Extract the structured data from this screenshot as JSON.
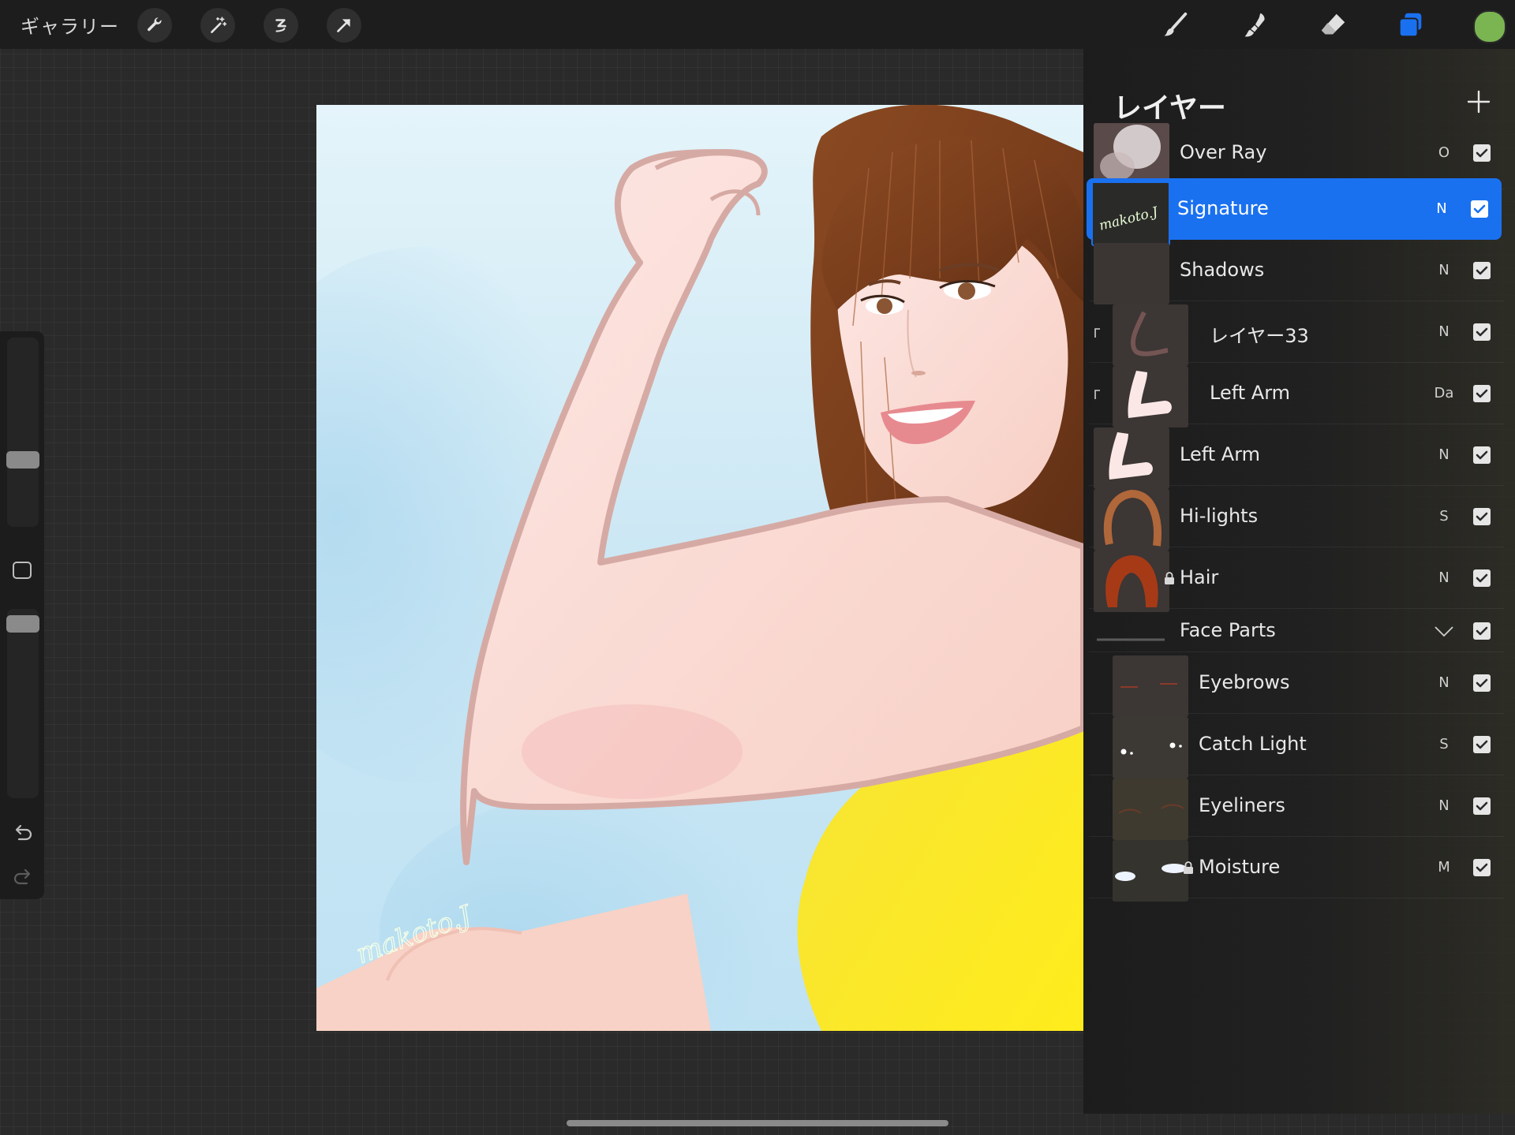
{
  "toolbar": {
    "gallery_label": "ギャラリー",
    "left_tools": [
      "wrench-icon",
      "magic-wand-icon",
      "selection-icon",
      "transform-arrow-icon"
    ],
    "right_tools": [
      "brush-icon",
      "smudge-icon",
      "eraser-icon",
      "layers-icon"
    ],
    "active_tool": "layers-icon",
    "current_color": "#7ab552",
    "accent_color": "#1a71f0"
  },
  "sidebar": {
    "brush_size_level": 0.35,
    "opacity_level": 0.06
  },
  "canvas": {
    "signature_text": "makoto.J"
  },
  "layers": {
    "title": "レイヤー",
    "add_icon": "plus-icon",
    "items": [
      {
        "name": "Over Ray",
        "blend": "O",
        "visible": true,
        "selected": false,
        "indent": false,
        "clipped": false,
        "locked": false
      },
      {
        "name": "Signature",
        "blend": "N",
        "visible": true,
        "selected": true,
        "indent": false,
        "clipped": false,
        "locked": false
      },
      {
        "name": "Shadows",
        "blend": "N",
        "visible": true,
        "selected": false,
        "indent": false,
        "clipped": false,
        "locked": false
      },
      {
        "name": "レイヤー33",
        "blend": "N",
        "visible": true,
        "selected": false,
        "indent": true,
        "clipped": true,
        "locked": false
      },
      {
        "name": "Left Arm",
        "blend": "Da",
        "visible": true,
        "selected": false,
        "indent": true,
        "clipped": true,
        "locked": false
      },
      {
        "name": "Left Arm",
        "blend": "N",
        "visible": true,
        "selected": false,
        "indent": false,
        "clipped": false,
        "locked": false
      },
      {
        "name": "Hi-lights",
        "blend": "S",
        "visible": true,
        "selected": false,
        "indent": false,
        "clipped": false,
        "locked": false
      },
      {
        "name": "Hair",
        "blend": "N",
        "visible": true,
        "selected": false,
        "indent": false,
        "clipped": false,
        "locked": true
      },
      {
        "name": "Face Parts",
        "blend": "",
        "visible": true,
        "selected": false,
        "indent": false,
        "clipped": false,
        "locked": false,
        "group": true
      },
      {
        "name": "Eyebrows",
        "blend": "N",
        "visible": true,
        "selected": false,
        "indent": true,
        "clipped": false,
        "locked": false
      },
      {
        "name": "Catch Light",
        "blend": "S",
        "visible": true,
        "selected": false,
        "indent": true,
        "clipped": false,
        "locked": false
      },
      {
        "name": "Eyeliners",
        "blend": "N",
        "visible": true,
        "selected": false,
        "indent": true,
        "clipped": false,
        "locked": false
      },
      {
        "name": "Moisture",
        "blend": "M",
        "visible": true,
        "selected": false,
        "indent": true,
        "clipped": false,
        "locked": true
      }
    ]
  }
}
